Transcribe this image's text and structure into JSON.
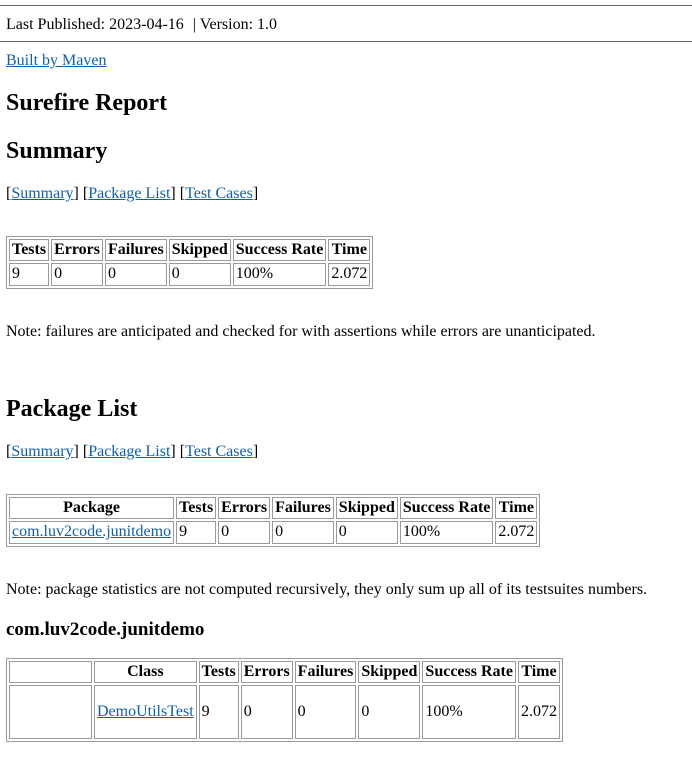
{
  "banner": {
    "published_label": "Last Published: 2023-04-16",
    "separator": "|",
    "version_label": "Version: 1.0"
  },
  "built_by": "Built by Maven",
  "report_title": "Surefire Report",
  "nav": {
    "summary": "Summary",
    "package_list": "Package List",
    "test_cases": "Test Cases"
  },
  "summary": {
    "title": "Summary",
    "headers": [
      "Tests",
      "Errors",
      "Failures",
      "Skipped",
      "Success Rate",
      "Time"
    ],
    "row": [
      "9",
      "0",
      "0",
      "0",
      "100%",
      "2.072"
    ],
    "note": "Note: failures are anticipated and checked for with assertions while errors are unanticipated."
  },
  "package_list": {
    "title": "Package List",
    "headers": [
      "Package",
      "Tests",
      "Errors",
      "Failures",
      "Skipped",
      "Success Rate",
      "Time"
    ],
    "row": [
      "com.luv2code.junitdemo",
      "9",
      "0",
      "0",
      "0",
      "100%",
      "2.072"
    ],
    "note": "Note: package statistics are not computed recursively, they only sum up all of its testsuites numbers."
  },
  "package_detail": {
    "title": "com.luv2code.junitdemo",
    "headers": [
      "",
      "Class",
      "Tests",
      "Errors",
      "Failures",
      "Skipped",
      "Success Rate",
      "Time"
    ],
    "row": [
      "",
      "DemoUtilsTest",
      "9",
      "0",
      "0",
      "0",
      "100%",
      "2.072"
    ]
  }
}
